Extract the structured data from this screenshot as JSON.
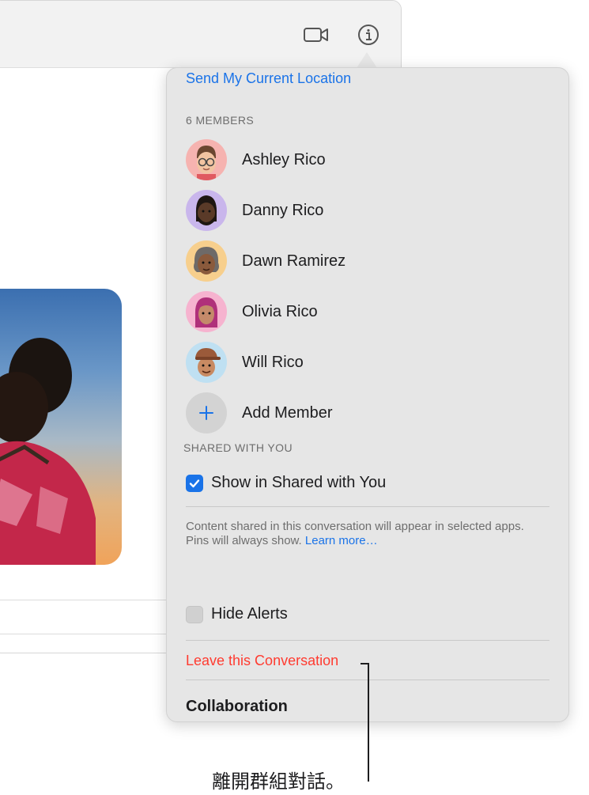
{
  "popover": {
    "send_location": "Send My Current Location",
    "members_header": "6 MEMBERS",
    "members": [
      {
        "name": "Ashley Rico",
        "avatar_color": "#f6b3b0"
      },
      {
        "name": "Danny Rico",
        "avatar_color": "#c9b6ec"
      },
      {
        "name": "Dawn Ramirez",
        "avatar_color": "#f7cf8d"
      },
      {
        "name": "Olivia Rico",
        "avatar_color": "#f6b3cf"
      },
      {
        "name": "Will Rico",
        "avatar_color": "#bfe0f2"
      }
    ],
    "add_member": "Add Member",
    "add_member_icon": "plus-icon",
    "shared_header": "SHARED WITH YOU",
    "show_shared_label": "Show in Shared with You",
    "show_shared_checked": true,
    "note_text": "Content shared in this conversation will appear in selected apps. Pins will always show.",
    "learn_more": "Learn more…",
    "hide_alerts_label": "Hide Alerts",
    "hide_alerts_checked": false,
    "leave_label": "Leave this Conversation",
    "collaboration_label": "Collaboration"
  },
  "toolbar": {
    "video_icon": "video-camera-icon",
    "info_icon": "info-icon"
  },
  "callout": {
    "text": "離開群組對話。"
  },
  "colors": {
    "accent": "#1a73e8",
    "destructive": "#ff3b30",
    "popover_bg": "#e6e6e6"
  }
}
